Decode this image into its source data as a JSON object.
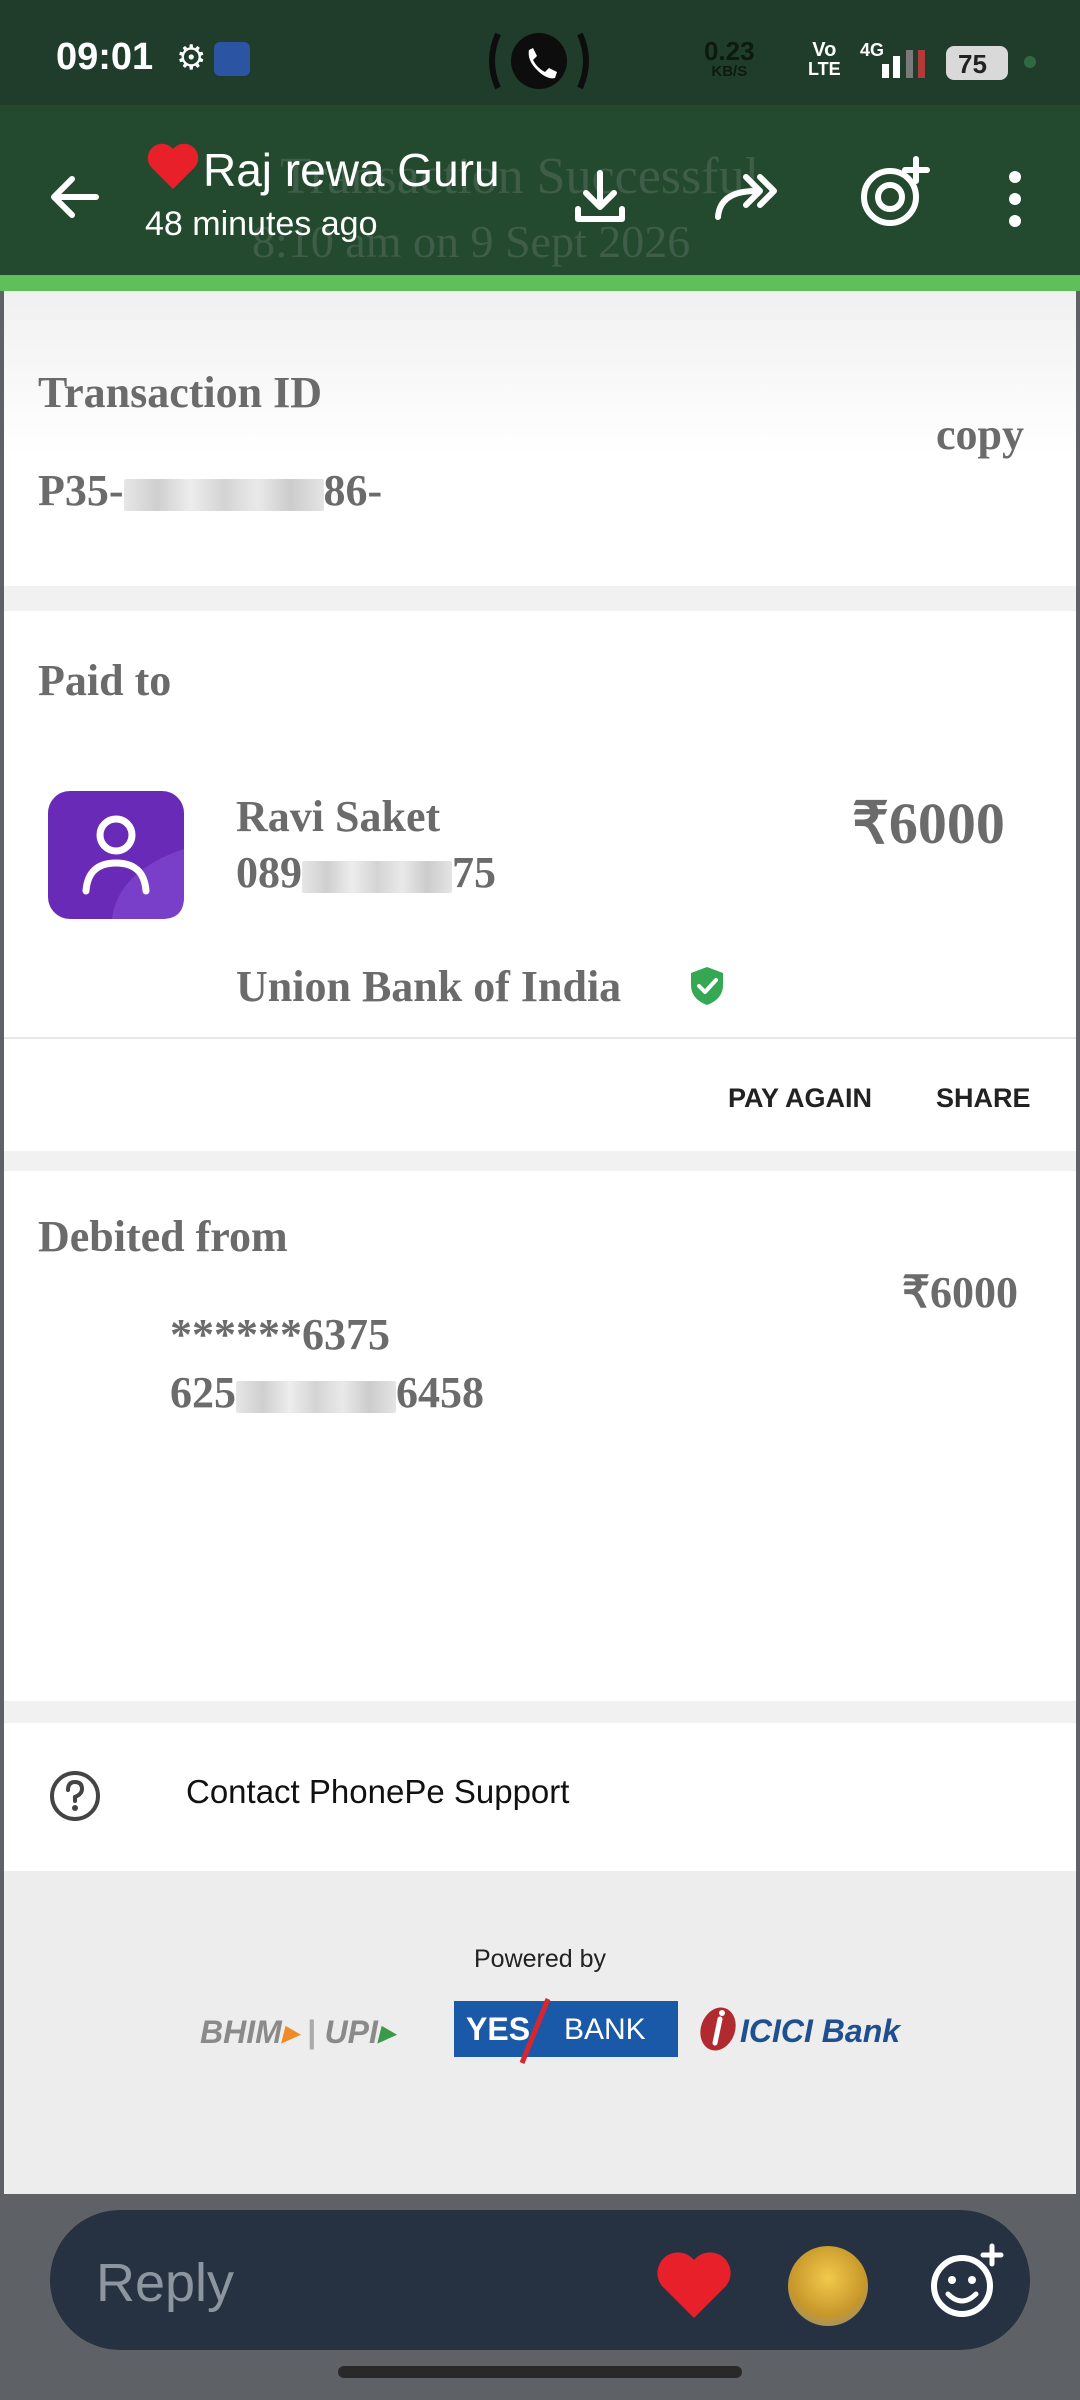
{
  "status_bar": {
    "time": "09:01",
    "net_speed_value": "0.23",
    "net_speed_unit": "KB/S",
    "volte_top": "Vo",
    "volte_bottom": "LTE",
    "network_type": "4G",
    "battery": "75"
  },
  "header": {
    "contact_name": "Raj rewa Guru",
    "subtitle": "48 minutes ago",
    "ghost_line1": "Transaction Successful",
    "ghost_line2": "8:10 am on 9 Sept 2026"
  },
  "receipt": {
    "transaction": {
      "title": "Transaction ID",
      "id_prefix": "P35-",
      "id_suffix": "86-",
      "copy_label": "copy"
    },
    "paid_to": {
      "title": "Paid to",
      "name": "Ravi Saket",
      "phone_prefix": "089",
      "phone_suffix": "75",
      "amount": "₹6000",
      "bank": "Union Bank of India",
      "pay_again": "PAY AGAIN",
      "share": "SHARE"
    },
    "debited_from": {
      "title": "Debited from",
      "account_masked": "******6375",
      "utr_prefix": "625",
      "utr_suffix": "6458",
      "amount": "₹6000"
    },
    "support": {
      "label": "Contact PhonePe Support"
    },
    "powered_by": {
      "label": "Powered by",
      "bhim": "BHIM",
      "upi": "UPI",
      "yes_left": "YES",
      "yes_right": "BANK",
      "icici": "ICICI Bank"
    }
  },
  "reply": {
    "placeholder": "Reply"
  },
  "colors": {
    "header_bg": "#234a2f",
    "accent_green": "#5fbf5a",
    "phonepe_purple": "#6a2ab8",
    "verified_green": "#34a853",
    "heart_red": "#e8202a"
  }
}
